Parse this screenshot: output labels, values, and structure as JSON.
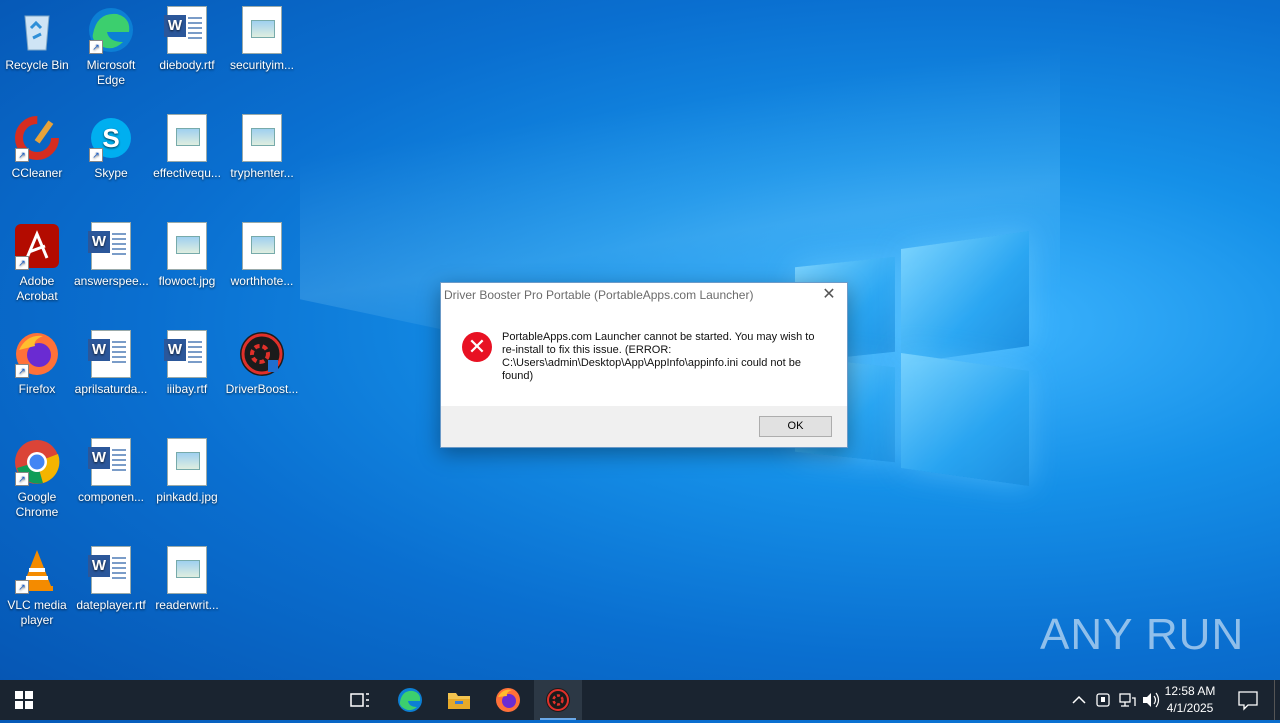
{
  "desktop": {
    "icons": [
      {
        "label": "Recycle Bin"
      },
      {
        "label": "Microsoft Edge"
      },
      {
        "label": "diebody.rtf"
      },
      {
        "label": "securityim..."
      },
      {
        "label": "CCleaner"
      },
      {
        "label": "Skype"
      },
      {
        "label": "effectivequ..."
      },
      {
        "label": "tryphenter..."
      },
      {
        "label": "Adobe Acrobat"
      },
      {
        "label": "answerspee..."
      },
      {
        "label": "flowoct.jpg"
      },
      {
        "label": "worthhote..."
      },
      {
        "label": "Firefox"
      },
      {
        "label": "aprilsaturda..."
      },
      {
        "label": "iiibay.rtf"
      },
      {
        "label": "DriverBoost..."
      },
      {
        "label": "Google Chrome"
      },
      {
        "label": "componen..."
      },
      {
        "label": "pinkadd.jpg"
      },
      {
        "label": "VLC media player"
      },
      {
        "label": "dateplayer.rtf"
      },
      {
        "label": "readerwrit..."
      }
    ]
  },
  "dialog": {
    "title": "Driver Booster Pro Portable (PortableApps.com Launcher)",
    "message": "PortableApps.com Launcher cannot be started. You may wish to re-install to fix this issue. (ERROR: C:\\Users\\admin\\Desktop\\App\\AppInfo\\appinfo.ini could not be found)",
    "ok_label": "OK"
  },
  "watermark": "ANY RUN",
  "taskbar": {
    "time": "12:58 AM",
    "date": "4/1/2025"
  },
  "colors": {
    "accent": "#0a6fd0",
    "error": "#e81123",
    "taskbar": "#1a2430"
  }
}
